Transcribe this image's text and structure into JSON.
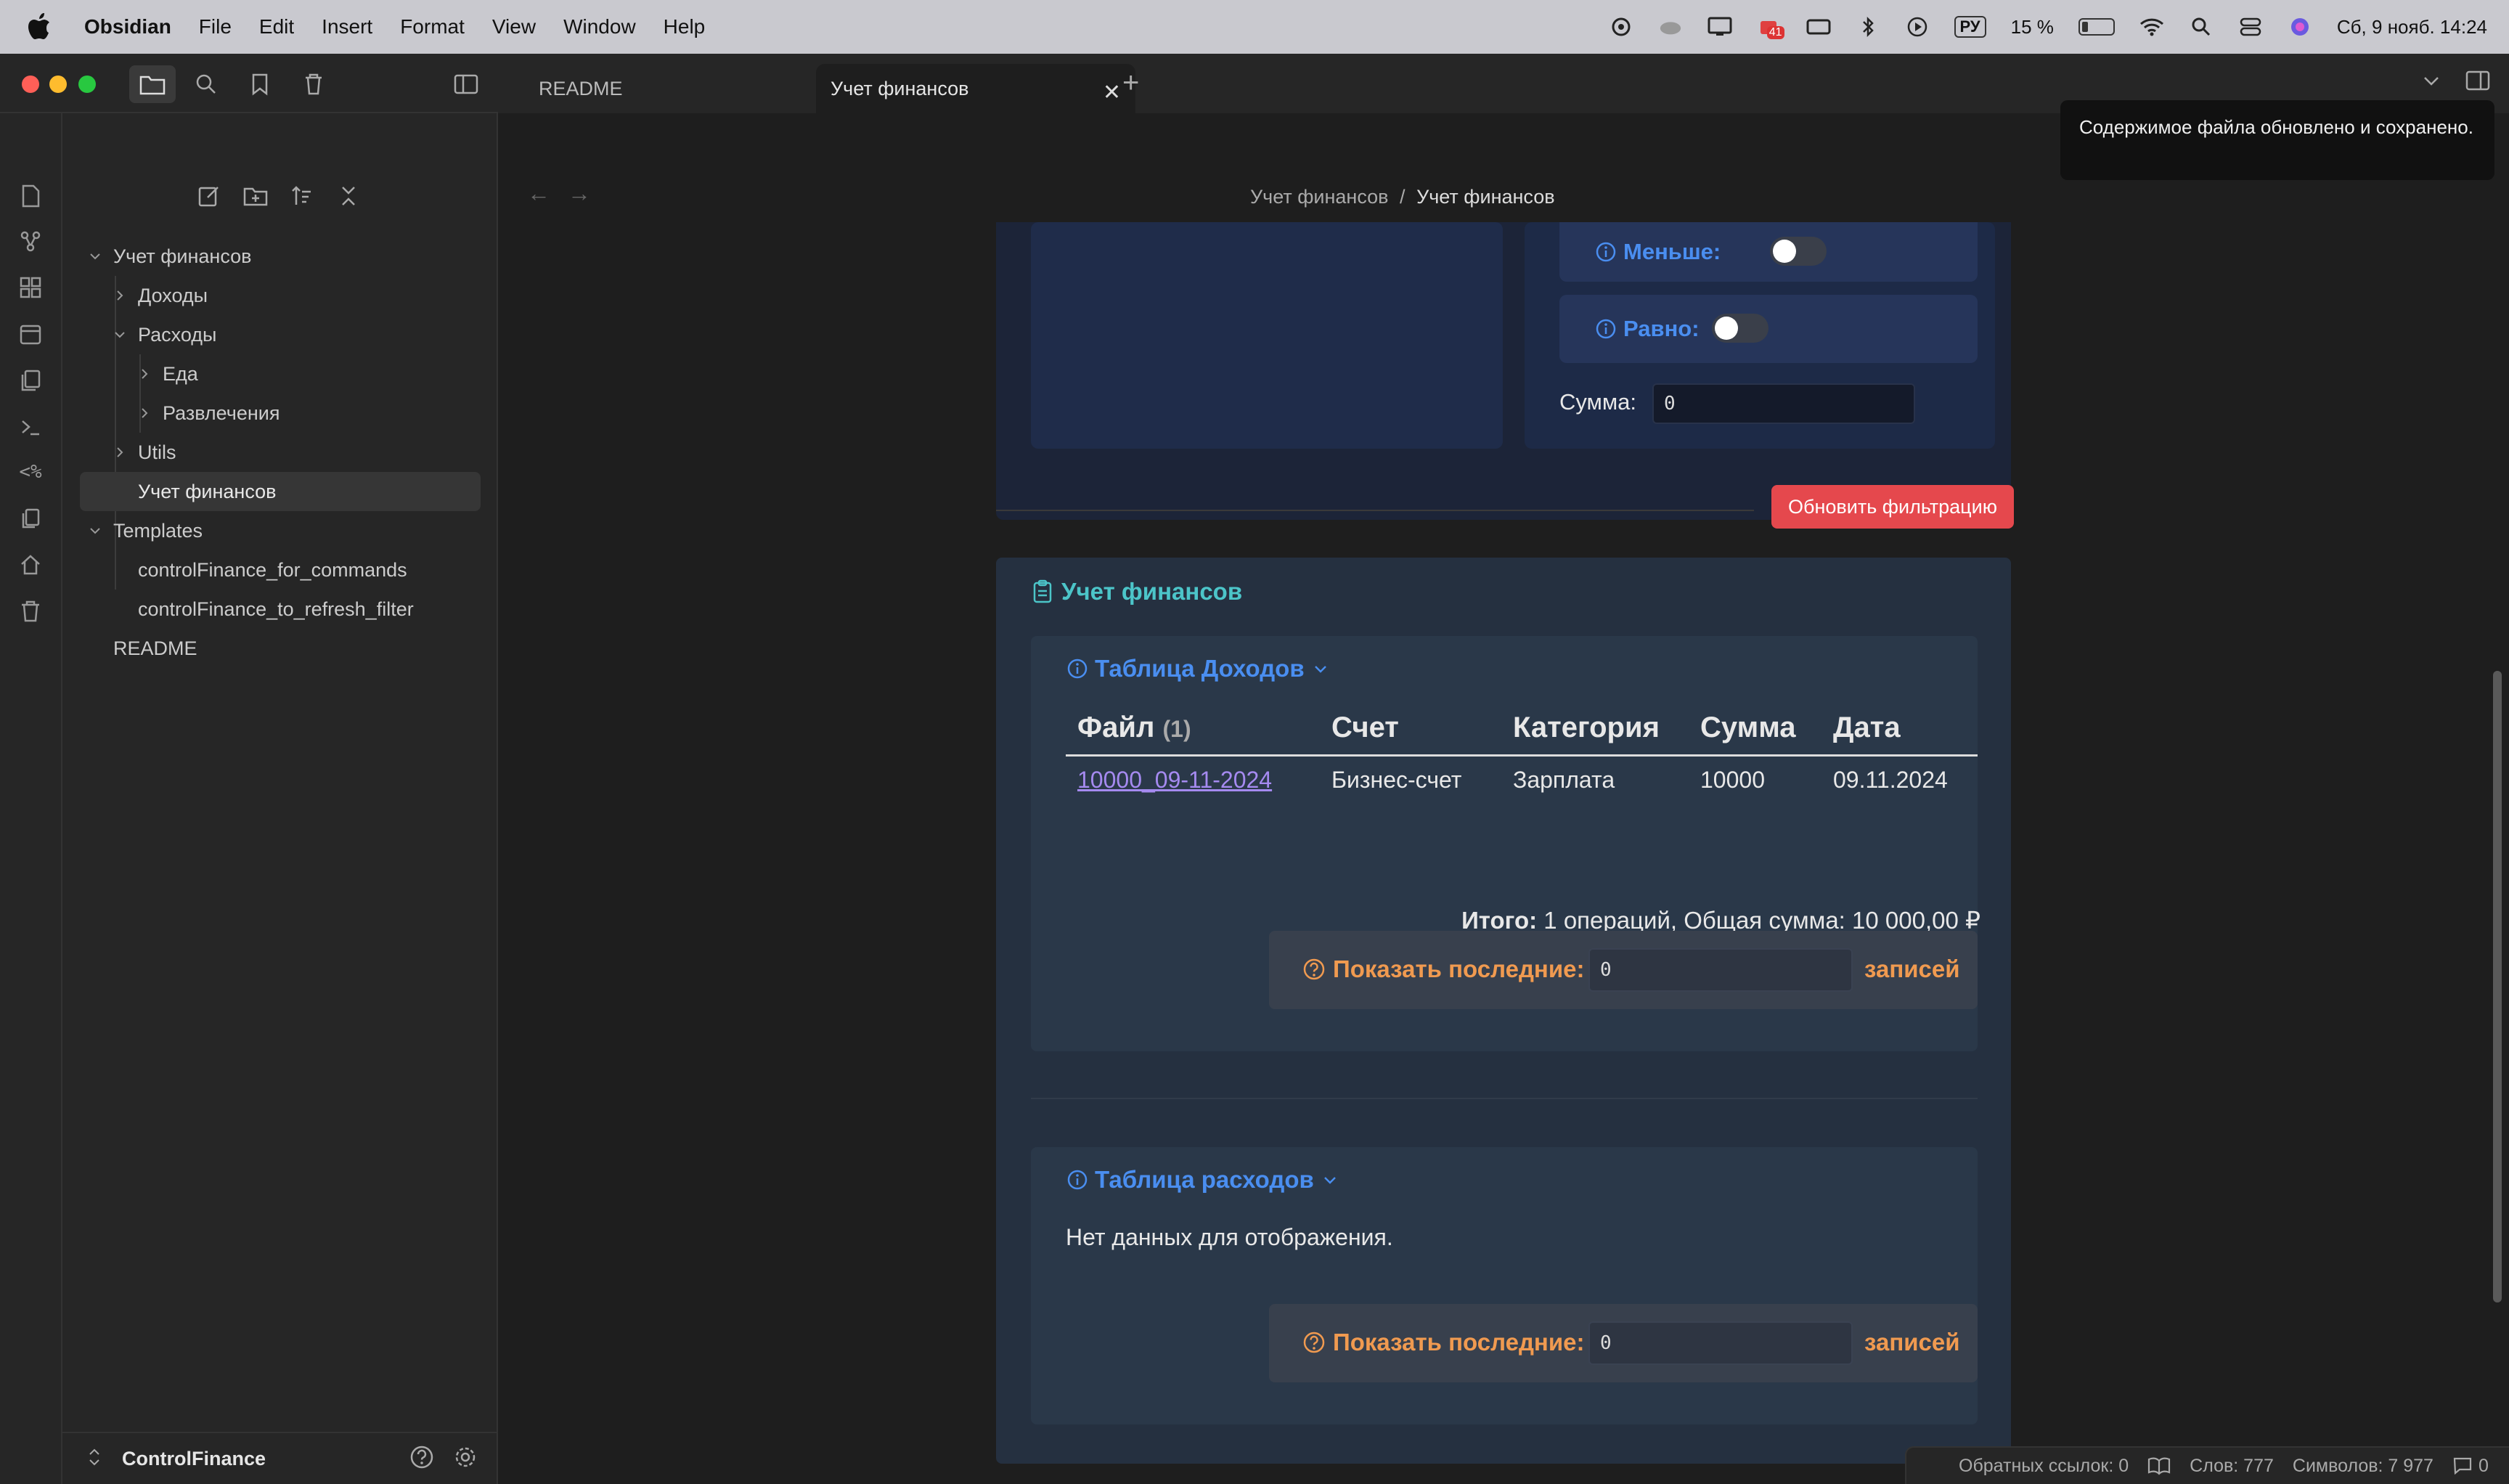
{
  "menubar": {
    "app_name": "Obsidian",
    "items": [
      "File",
      "Edit",
      "Insert",
      "Format",
      "View",
      "Window",
      "Help"
    ],
    "language": "РУ",
    "battery": "15 %",
    "notification_badge": "41",
    "datetime": "Сб, 9 нояб.  14:24"
  },
  "tabs": [
    {
      "label": "README"
    },
    {
      "label": "Учет финансов"
    }
  ],
  "sidebar": {
    "tree": [
      {
        "label": "Учет финансов"
      },
      {
        "label": "Доходы"
      },
      {
        "label": "Расходы"
      },
      {
        "label": "Еда"
      },
      {
        "label": "Развлечения"
      },
      {
        "label": "Utils"
      },
      {
        "label": "Учет финансов"
      },
      {
        "label": "Templates"
      },
      {
        "label": "controlFinance_for_commands"
      },
      {
        "label": "controlFinance_to_refresh_filter"
      },
      {
        "label": "README"
      }
    ],
    "vault_name": "ControlFinance"
  },
  "breadcrumb": {
    "folder": "Учет финансов",
    "separator": "/",
    "file": "Учет финансов"
  },
  "filters": {
    "less_label": "Меньше:",
    "equal_label": "Равно:",
    "sum_label": "Сумма:",
    "sum_value": "0",
    "refresh_button": "Обновить фильтрацию"
  },
  "finance": {
    "title": "Учет финансов",
    "income": {
      "title": "Таблица Доходов",
      "headers": [
        "Файл",
        "Счет",
        "Категория",
        "Сумма",
        "Дата"
      ],
      "file_count": "(1)",
      "rows": [
        [
          "10000_09-11-2024",
          "Бизнес-счет",
          "Зарплата",
          "10000",
          "09.11.2024"
        ]
      ],
      "totals_label": "Итого:",
      "totals_text": " 1 операций, Общая сумма: 10 000,00 ₽",
      "show_last_label": "Показать последние:",
      "show_last_value": "0",
      "records_label": "записей"
    },
    "expenses": {
      "title": "Таблица расходов",
      "empty_text": "Нет данных для отображения.",
      "show_last_label": "Показать последние:",
      "show_last_value": "0",
      "records_label": "записей"
    }
  },
  "toast": {
    "text": "Содержимое файла обновлено и сохранено."
  },
  "statusbar": {
    "backlinks": "Обратных ссылок: 0",
    "words": "Слов: 777",
    "chars": "Символов: 7 977",
    "comments": "0"
  },
  "colors": {
    "accent_blue": "#4a8ef0",
    "accent_teal": "#4cc5c9",
    "accent_orange": "#f09a50",
    "button_red": "#e5484d",
    "link_purple": "#a58af0"
  }
}
